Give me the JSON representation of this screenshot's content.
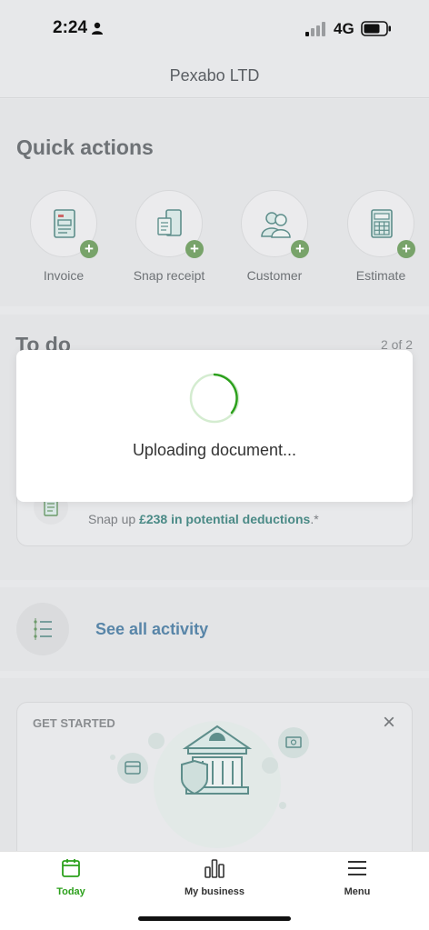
{
  "status_bar": {
    "time": "2:24",
    "network": "4G"
  },
  "header": {
    "title": "Pexabo LTD"
  },
  "quick_actions": {
    "title": "Quick actions",
    "items": [
      {
        "label": "Invoice",
        "icon": "invoice-icon"
      },
      {
        "label": "Snap receipt",
        "icon": "snap-receipt-icon"
      },
      {
        "label": "Customer",
        "icon": "customer-icon"
      },
      {
        "label": "Estimate",
        "icon": "estimate-icon"
      }
    ],
    "plus_symbol": "+"
  },
  "todo": {
    "title": "To do",
    "count": "2 of 2",
    "card": {
      "text_prefix": "Snap up ",
      "text_highlight": "£238 in potential deductions",
      "text_suffix": ".*"
    }
  },
  "activity": {
    "link_label": "See all activity"
  },
  "get_started": {
    "label": "GET STARTED",
    "close_symbol": "×"
  },
  "loading": {
    "message": "Uploading document..."
  },
  "tab_bar": {
    "tabs": [
      {
        "label": "Today",
        "icon": "calendar-icon",
        "active": true
      },
      {
        "label": "My business",
        "icon": "bar-chart-icon",
        "active": false
      },
      {
        "label": "Menu",
        "icon": "hamburger-icon",
        "active": false
      }
    ]
  },
  "colors": {
    "accent_green": "#2ca01c",
    "link_blue": "#5885a8",
    "teal": "#4a8a86"
  }
}
